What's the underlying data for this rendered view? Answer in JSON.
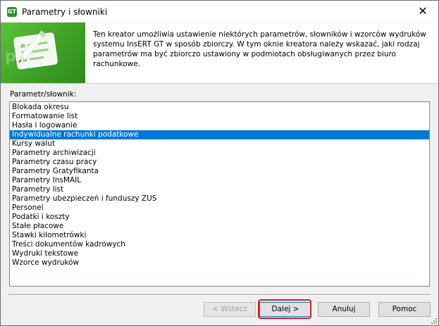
{
  "window": {
    "title": "Parametry i słowniki",
    "icon_text": "GT",
    "close_glyph": "✕"
  },
  "header": {
    "watermark": "param",
    "description": "Ten kreator umożliwia ustawienie niektórych parametrów, słowników i wzorców wydruków systemu InsERT GT w sposób zbiorczy. W tym oknie kreatora należy wskazać, jaki rodzaj parametrów ma być zbiorczo ustawiony w podmiotach obsługiwanych przez biuro rachunkowe."
  },
  "list": {
    "label": "Parametr/słownik:",
    "selected": "Indywidualne rachunki podatkowe",
    "items": [
      "Blokada okresu",
      "Formatowanie list",
      "Hasła i logowanie",
      "Indywidualne rachunki podatkowe",
      "Kursy walut",
      "Parametry archiwizacji",
      "Parametry czasu pracy",
      "Parametry Gratyfikanta",
      "Parametry InsMAIL",
      "Parametry list",
      "Parametry ubezpieczeń i funduszy ZUS",
      "Personel",
      "Podatki i koszty",
      "Stałe płacowe",
      "Stawki kilometrówki",
      "Treści dokumentów kadrowych",
      "Wydruki tekstowe",
      "Wzorce wydruków"
    ]
  },
  "buttons": {
    "back": "< Wstecz",
    "next": "Dalej >",
    "cancel": "Anuluj",
    "help": "Pomoc"
  },
  "colors": {
    "selection": "#0078d7",
    "hero_green": "#3fa126",
    "highlight_red": "#d42020"
  }
}
